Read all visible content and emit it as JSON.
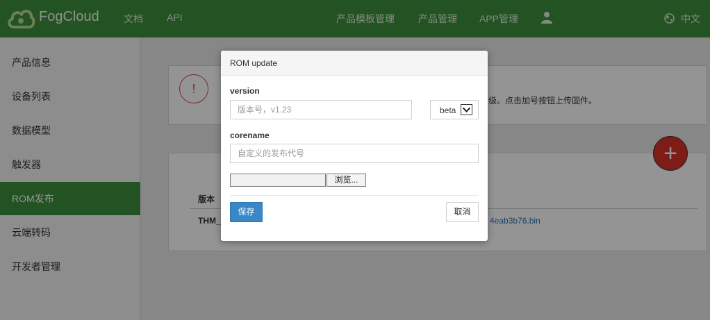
{
  "topbar": {
    "brand": "FogCloud",
    "nav_docs": "文档",
    "nav_api": "API",
    "nav_templates": "产品模板管理",
    "nav_products": "产品管理",
    "nav_app": "APP管理",
    "language": "中文",
    "icons": [
      "cloud-logo-icon",
      "user-icon",
      "globe-icon"
    ]
  },
  "sidebar": {
    "items": [
      {
        "label": "产品信息"
      },
      {
        "label": "设备列表"
      },
      {
        "label": "数据模型"
      },
      {
        "label": "触发器"
      },
      {
        "label": "ROM发布",
        "active": true
      },
      {
        "label": "云端转码"
      },
      {
        "label": "开发者管理"
      }
    ]
  },
  "main": {
    "alert_icon": "!",
    "alert_text": "级。点击加号按钮上传固件。",
    "add_symbol": "+",
    "table": {
      "header_version": "版本",
      "row_version": "THM_",
      "row_file": "4eab3b76.bin"
    }
  },
  "modal": {
    "title": "ROM update",
    "version_label": "version",
    "version_placeholder": "版本号，v1.23",
    "channel_value": "beta",
    "corename_label": "corename",
    "corename_placeholder": "自定义的发布代号",
    "browse_label": "浏览...",
    "save_label": "保存",
    "cancel_label": "取消"
  },
  "colors": {
    "brand_green": "#3f8f3d",
    "primary_blue": "#3a87c8",
    "add_red": "#d93328",
    "alert_red": "#d24b43"
  }
}
